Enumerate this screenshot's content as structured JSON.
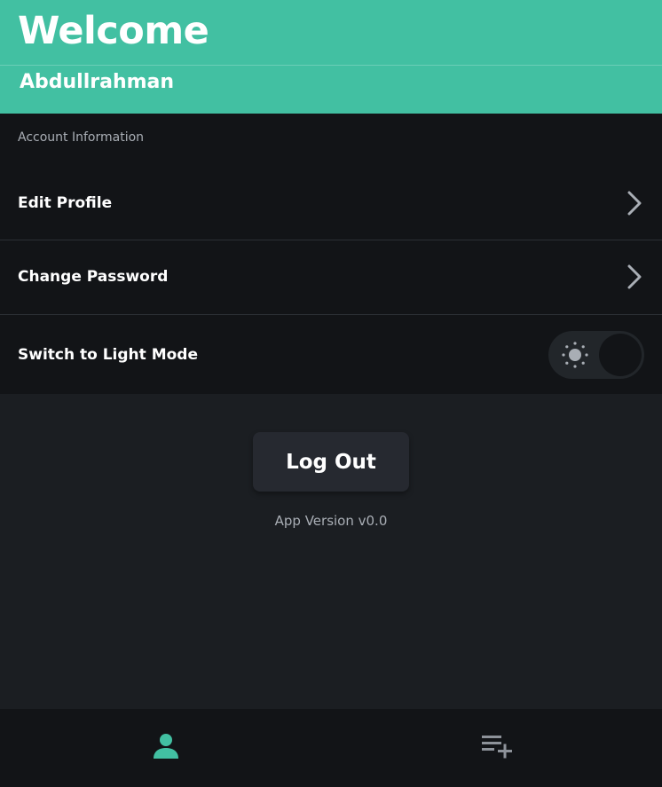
{
  "header": {
    "title": "Welcome",
    "username": "Abdullrahman"
  },
  "settings": {
    "section_label": "Account Information",
    "items": [
      {
        "label": "Edit Profile",
        "icon": "chevron-right-icon"
      },
      {
        "label": "Change Password",
        "icon": "chevron-right-icon"
      },
      {
        "label": "Switch to Light Mode",
        "icon": "sun-icon",
        "toggle_on": false
      }
    ]
  },
  "logout": {
    "label": "Log Out"
  },
  "app_version": "App Version v0.0",
  "bottom_nav": {
    "items": [
      {
        "icon": "person-icon",
        "active": true
      },
      {
        "icon": "playlist-add-icon",
        "active": false
      }
    ]
  },
  "colors": {
    "accent": "#42c0a2",
    "background": "#1b1e22",
    "surface": "#121417",
    "muted_text": "#a9aeb5"
  }
}
